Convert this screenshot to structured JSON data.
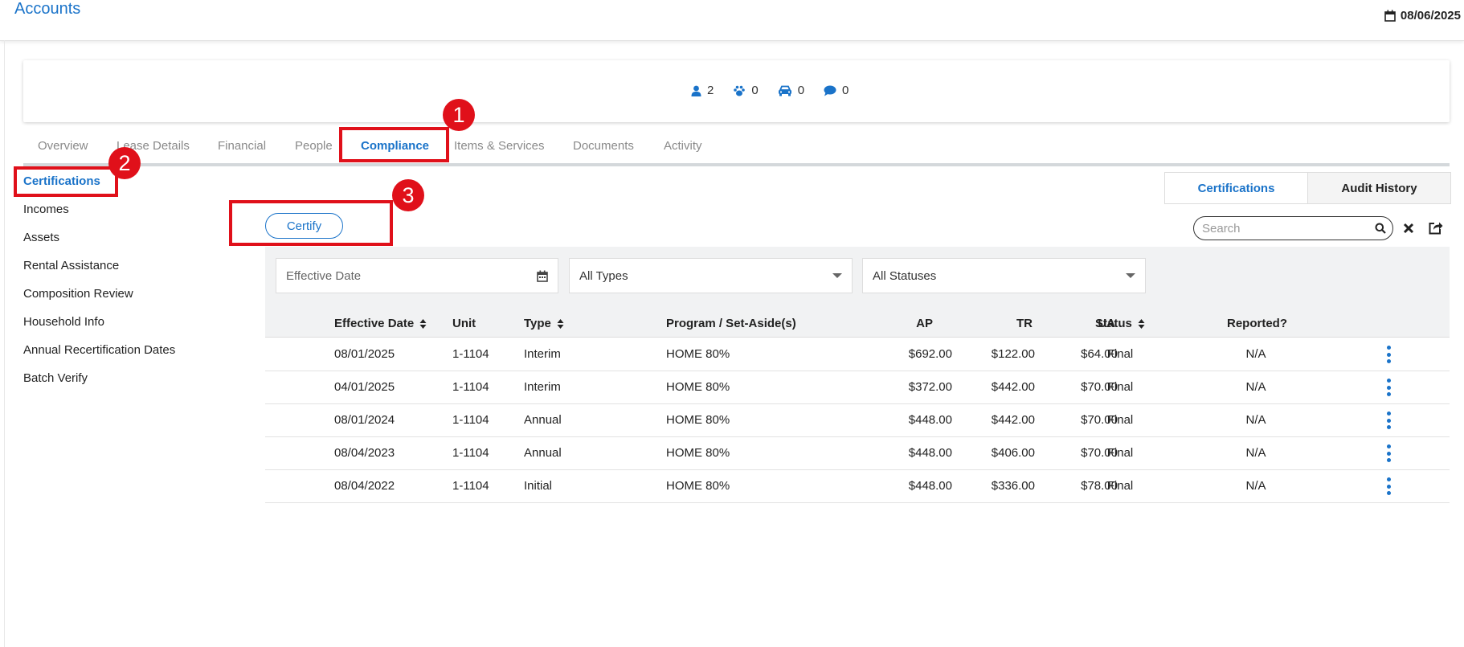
{
  "header": {
    "title": "Accounts",
    "date": "08/06/2025"
  },
  "summary": {
    "people": "2",
    "pets": "0",
    "vehicles": "0",
    "comments": "0"
  },
  "tabs": [
    "Overview",
    "Lease Details",
    "Financial",
    "People",
    "Compliance",
    "Items & Services",
    "Documents",
    "Activity"
  ],
  "sidenav": [
    "Certifications",
    "Incomes",
    "Assets",
    "Rental Assistance",
    "Composition Review",
    "Household Info",
    "Annual Recertification Dates",
    "Batch Verify"
  ],
  "segment": {
    "left": "Certifications",
    "right": "Audit History"
  },
  "certify_label": "Certify",
  "search_placeholder": "Search",
  "filters": {
    "date_placeholder": "Effective Date",
    "type": "All Types",
    "status": "All Statuses"
  },
  "columns": [
    "Effective Date",
    "Unit",
    "Type",
    "Program / Set-Aside(s)",
    "AP",
    "TR",
    "UA",
    "Status",
    "Reported?"
  ],
  "rows": [
    [
      "08/01/2025",
      "1-1104",
      "Interim",
      "HOME 80%",
      "$692.00",
      "$122.00",
      "$64.00",
      "Final",
      "N/A"
    ],
    [
      "04/01/2025",
      "1-1104",
      "Interim",
      "HOME 80%",
      "$372.00",
      "$442.00",
      "$70.00",
      "Final",
      "N/A"
    ],
    [
      "08/01/2024",
      "1-1104",
      "Annual",
      "HOME 80%",
      "$448.00",
      "$442.00",
      "$70.00",
      "Final",
      "N/A"
    ],
    [
      "08/04/2023",
      "1-1104",
      "Annual",
      "HOME 80%",
      "$448.00",
      "$406.00",
      "$70.00",
      "Final",
      "N/A"
    ],
    [
      "08/04/2022",
      "1-1104",
      "Initial",
      "HOME 80%",
      "$448.00",
      "$336.00",
      "$78.00",
      "Final",
      "N/A"
    ]
  ],
  "annotations": [
    "1",
    "2",
    "3"
  ],
  "colors": {
    "accent": "#1a73c9",
    "annotation": "#e0101a"
  }
}
